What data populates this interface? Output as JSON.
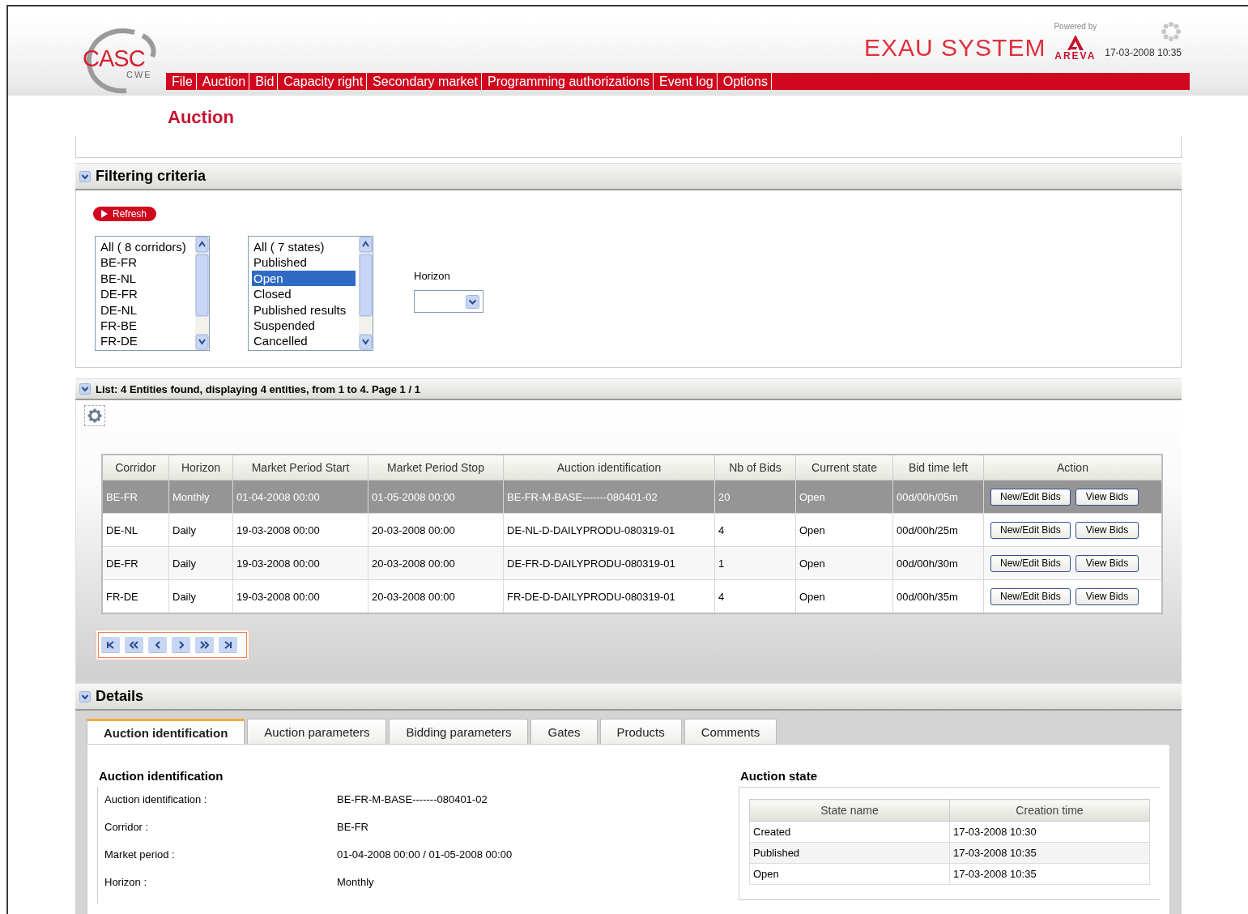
{
  "logo": {
    "text": "CASC",
    "subtext": "CWE"
  },
  "brand": {
    "system": "EXAU SYSTEM",
    "powered_by": "Powered by",
    "vendor": "AREVA",
    "datetime": "17-03-2008 10:35"
  },
  "menu": [
    "File",
    "Auction",
    "Bid",
    "Capacity right",
    "Secondary market",
    "Programming authorizations",
    "Event log",
    "Options"
  ],
  "page_title": "Auction",
  "filtering": {
    "title": "Filtering criteria",
    "refresh": "Refresh",
    "corridors": [
      {
        "label": "All ( 8 corridors)",
        "selected": false
      },
      {
        "label": "BE-FR",
        "selected": false
      },
      {
        "label": "BE-NL",
        "selected": false
      },
      {
        "label": "DE-FR",
        "selected": false
      },
      {
        "label": "DE-NL",
        "selected": false
      },
      {
        "label": "FR-BE",
        "selected": false
      },
      {
        "label": "FR-DE",
        "selected": false
      }
    ],
    "states": [
      {
        "label": "All ( 7 states)",
        "selected": false
      },
      {
        "label": "Published",
        "selected": false
      },
      {
        "label": "Open",
        "selected": true
      },
      {
        "label": "Closed",
        "selected": false
      },
      {
        "label": "Published results",
        "selected": false
      },
      {
        "label": "Suspended",
        "selected": false
      },
      {
        "label": "Cancelled",
        "selected": false
      }
    ],
    "horizon": {
      "label": "Horizon"
    }
  },
  "list": {
    "title": "List: 4 Entities found, displaying 4 entities, from 1 to 4. Page 1 / 1",
    "columns": [
      "Corridor",
      "Horizon",
      "Market Period Start",
      "Market Period Stop",
      "Auction identification",
      "Nb of Bids",
      "Current state",
      "Bid time left",
      "Action"
    ],
    "rows": [
      {
        "selected": true,
        "cells": [
          "BE-FR",
          "Monthly",
          "01-04-2008 00:00",
          "01-05-2008 00:00",
          "BE-FR-M-BASE-------080401-02",
          "20",
          "Open",
          "00d/00h/05m"
        ],
        "actions": [
          "New/Edit Bids",
          "View Bids"
        ]
      },
      {
        "selected": false,
        "cells": [
          "DE-NL",
          "Daily",
          "19-03-2008 00:00",
          "20-03-2008 00:00",
          "DE-NL-D-DAILYPRODU-080319-01",
          "4",
          "Open",
          "00d/00h/25m"
        ],
        "actions": [
          "New/Edit Bids",
          "View Bids"
        ]
      },
      {
        "selected": false,
        "cells": [
          "DE-FR",
          "Daily",
          "19-03-2008 00:00",
          "20-03-2008 00:00",
          "DE-FR-D-DAILYPRODU-080319-01",
          "1",
          "Open",
          "00d/00h/30m"
        ],
        "actions": [
          "New/Edit Bids",
          "View Bids"
        ]
      },
      {
        "selected": false,
        "cells": [
          "FR-DE",
          "Daily",
          "19-03-2008 00:00",
          "20-03-2008 00:00",
          "FR-DE-D-DAILYPRODU-080319-01",
          "4",
          "Open",
          "00d/00h/35m"
        ],
        "actions": [
          "New/Edit Bids",
          "View Bids"
        ]
      }
    ],
    "pager": [
      {
        "kind": "first"
      },
      {
        "kind": "fast_back"
      },
      {
        "kind": "back"
      },
      {
        "kind": "forward"
      },
      {
        "kind": "fast_forward"
      },
      {
        "kind": "last"
      }
    ]
  },
  "details": {
    "title": "Details",
    "tabs": [
      {
        "label": "Auction identification",
        "selected": true
      },
      {
        "label": "Auction parameters",
        "selected": false
      },
      {
        "label": "Bidding parameters",
        "selected": false
      },
      {
        "label": "Gates",
        "selected": false
      },
      {
        "label": "Products",
        "selected": false
      },
      {
        "label": "Comments",
        "selected": false
      }
    ],
    "identification": {
      "title": "Auction identification",
      "fields": [
        {
          "label": "Auction identification :",
          "value": "BE-FR-M-BASE-------080401-02"
        },
        {
          "label": "Corridor :",
          "value": "BE-FR"
        },
        {
          "label": "Market period :",
          "value": "01-04-2008 00:00 / 01-05-2008 00:00"
        },
        {
          "label": "Horizon :",
          "value": "Monthly"
        }
      ]
    },
    "state": {
      "title": "Auction state",
      "columns": [
        "State name",
        "Creation time"
      ],
      "rows": [
        [
          "Created",
          "17-03-2008 10:30"
        ],
        [
          "Published",
          "17-03-2008 10:35"
        ],
        [
          "Open",
          "17-03-2008 10:35"
        ]
      ]
    }
  }
}
